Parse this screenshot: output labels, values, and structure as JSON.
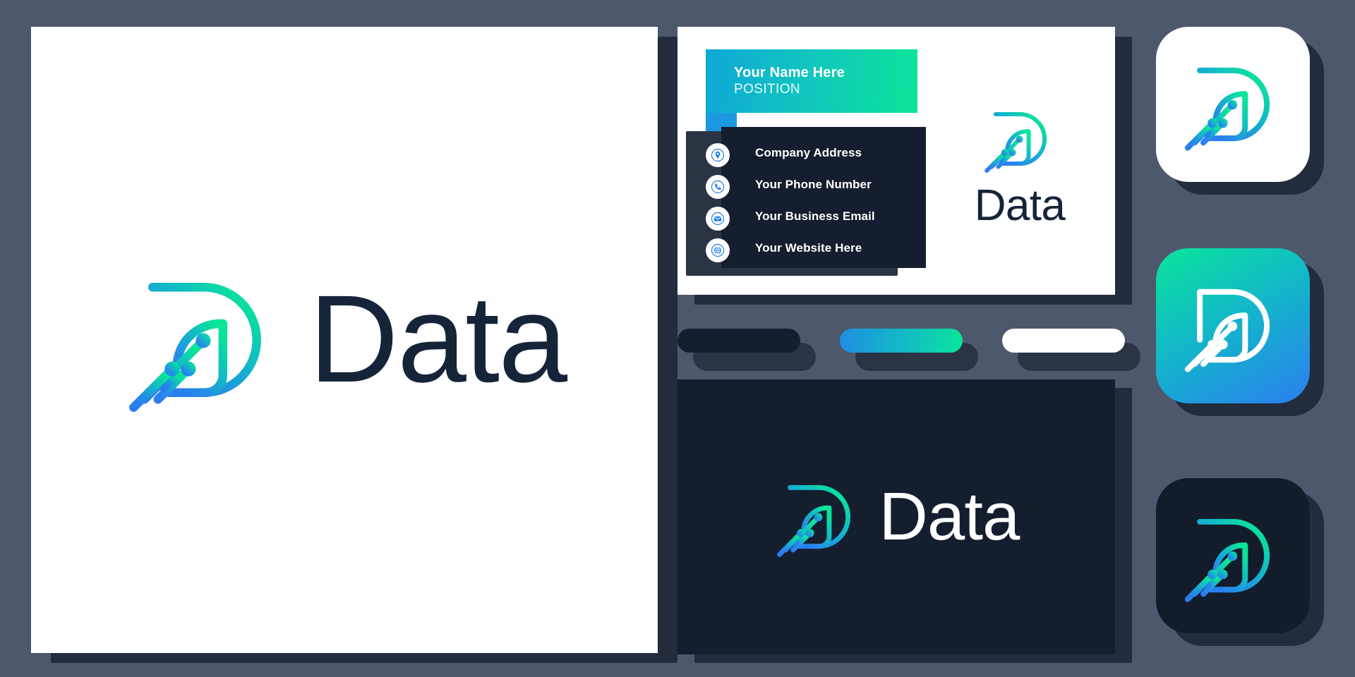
{
  "page": {
    "background_color": "#4e586d",
    "brand_name": "Data"
  },
  "palette": {
    "navy": "#151e2e",
    "wordmark_navy": "#16243a",
    "teal": "#0ae59a",
    "blue": "#2a7ef0",
    "white": "#ffffff",
    "slate_background": "#4e586d",
    "shadow": "#222c3d"
  },
  "main_board": {
    "name": "primary-logo-board",
    "wordmark": "Data",
    "background": "#ffffff"
  },
  "business_card": {
    "name_block": {
      "name": "Your Name Here",
      "position": "POSITION",
      "gradient_from": "#0fa8d8",
      "gradient_to": "#0ae59a"
    },
    "contact_items": [
      {
        "icon": "location-pin-icon",
        "label": "Company Address"
      },
      {
        "icon": "phone-icon",
        "label": "Your Phone Number"
      },
      {
        "icon": "envelope-icon",
        "label": "Your Business Email"
      },
      {
        "icon": "globe-icon",
        "label": "Your Website Here"
      }
    ],
    "logo_wordmark": "Data"
  },
  "color_pills": [
    {
      "name": "navy-swatch",
      "color": "#151e2e",
      "type": "solid"
    },
    {
      "name": "gradient-swatch",
      "color": "#0ae59a",
      "type": "gradient"
    },
    {
      "name": "white-swatch",
      "color": "#ffffff",
      "type": "solid"
    }
  ],
  "dark_board": {
    "name": "dark-logo-board",
    "wordmark": "Data",
    "background": "#151e2e"
  },
  "app_tiles": [
    {
      "name": "app-icon-light",
      "background": "#ffffff",
      "mark_style": "gradient"
    },
    {
      "name": "app-icon-gradient",
      "background": "#0ae59a",
      "mark_style": "white"
    },
    {
      "name": "app-icon-dark",
      "background": "#131c2b",
      "mark_style": "gradient"
    }
  ]
}
